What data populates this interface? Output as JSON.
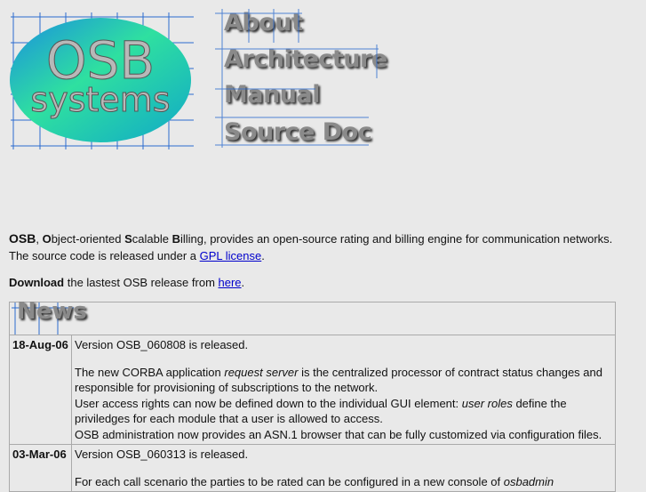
{
  "logo": {
    "line1": "OSB",
    "line2": "systems"
  },
  "nav": [
    {
      "label": "About"
    },
    {
      "label": "Architecture"
    },
    {
      "label": "Manual"
    },
    {
      "label": "Source Doc"
    }
  ],
  "intro": {
    "osb": "OSB",
    "sep1": ", ",
    "o": "O",
    "o_rest": "bject-oriented ",
    "s": "S",
    "s_rest": "calable ",
    "b": "B",
    "b_rest": "illing, provides an open-source rating and billing engine for communication networks.",
    "line2_pre": "The source code is released under a ",
    "gpl_link": "GPL license",
    "line2_post": ".",
    "download": "Download",
    "download_mid": " the lastest OSB release from ",
    "here_link": "here",
    "download_end": "."
  },
  "news": {
    "title": "News",
    "items": [
      {
        "date": "18-Aug-06",
        "headline": "Version OSB_060808 is released.",
        "p1_pre": "The new CORBA application ",
        "p1_em": "request server",
        "p1_post": " is the centralized processor of contract status changes and responsible for provisioning of subscriptions to the network.",
        "p2_pre": "User access rights can now be defined down to the individual GUI element: ",
        "p2_em": "user roles",
        "p2_post": " define the priviledges for each module that a user is allowed to access.",
        "p3": "OSB administration now provides an ASN.1 browser that can be fully customized via configuration files."
      },
      {
        "date": "03-Mar-06",
        "headline": "Version OSB_060313 is released.",
        "p1_pre": "For each call scenario the parties to be rated can be configured in a new console of ",
        "p1_em": "osbadmin"
      }
    ]
  }
}
